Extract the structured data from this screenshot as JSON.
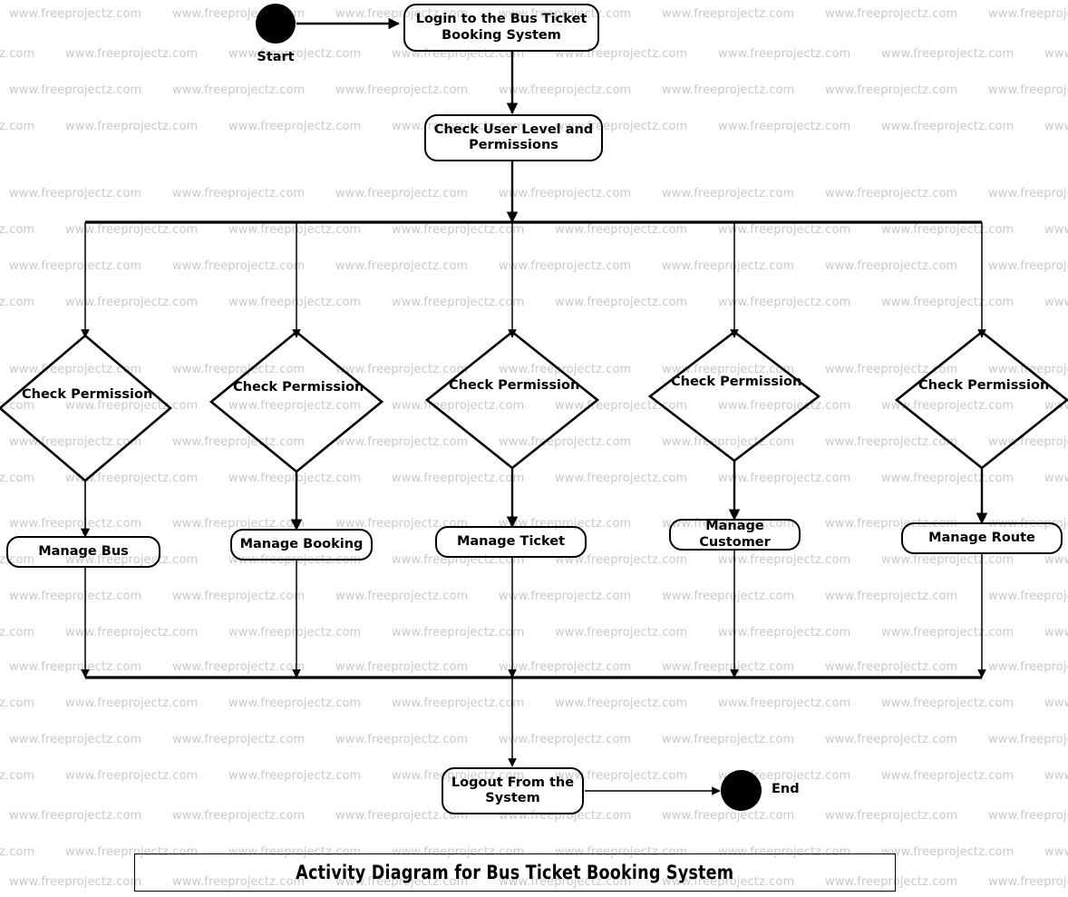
{
  "diagram": {
    "caption": "Activity Diagram for Bus Ticket Booking System",
    "type": "uml-activity-diagram",
    "watermark_text": "www.freeprojectz.com",
    "colors": {
      "stroke": "#000000",
      "background": "#ffffff",
      "watermark": "#c9c9c9"
    },
    "start": {
      "label": "Start"
    },
    "end": {
      "label": "End"
    },
    "actions": {
      "login": "Login to the Bus Ticket Booking System",
      "check_user": "Check User Level and Permissions",
      "logout": "Logout From the System"
    },
    "decisions": [
      {
        "label": "Check Permission"
      },
      {
        "label": "Check Permission"
      },
      {
        "label": "Check Permission"
      },
      {
        "label": "Check Permission"
      },
      {
        "label": "Check Permission"
      }
    ],
    "manage_activities": [
      {
        "label": "Manage Bus"
      },
      {
        "label": "Manage Booking"
      },
      {
        "label": "Manage Ticket"
      },
      {
        "label": "Manage Customer"
      },
      {
        "label": "Manage Route"
      }
    ]
  }
}
